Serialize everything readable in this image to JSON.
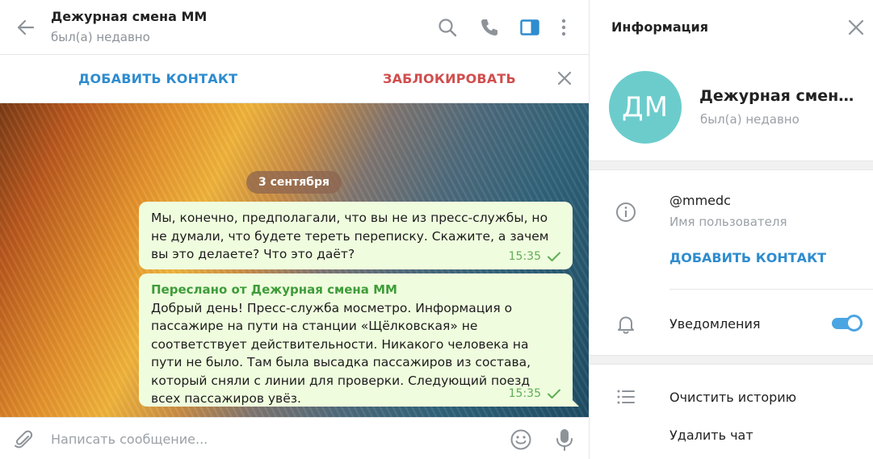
{
  "chat": {
    "title": "Дежурная смена ММ",
    "status": "был(а) недавно",
    "icons": [
      "back-arrow-icon",
      "search-icon",
      "phone-icon",
      "sidebar-toggle-icon",
      "more-vertical-icon"
    ],
    "accent_color": "#2e8ccf"
  },
  "action_bar": {
    "add_contact": "ДОБАВИТЬ КОНТАКТ",
    "block": "ЗАБЛОКИРОВАТЬ",
    "block_color": "#d14e4e"
  },
  "messages": {
    "date": "3 сентября",
    "items": [
      {
        "text": "Мы, конечно, предполагали, что вы не из пресс-службы, но не думали, что будете тереть переписку. Скажите, а зачем вы это делаете? Что это даёт?",
        "time": "15:35"
      },
      {
        "forwarded_from": "Переслано от Дежурная смена ММ",
        "text": "Добрый день! Пресс-служба мосметро. Информация о пассажире на пути на станции «Щёлковская» не соответствует действительности. Никакого человека на пути не было. Там была высадка пассажиров из состава, который сняли с линии для проверки. Следующий поезд всех пассажиров увёз.",
        "time": "15:35"
      }
    ],
    "bubble_color": "#effdde"
  },
  "composer": {
    "placeholder": "Написать сообщение...",
    "value": ""
  },
  "info_panel": {
    "title": "Информация",
    "avatar_initials": "ДМ",
    "avatar_color": "#6ccccc",
    "name": "Дежурная смена ММ",
    "status": "был(а) недавно",
    "username": "@mmedc",
    "username_label": "Имя пользователя",
    "add_contact": "ДОБАВИТЬ КОНТАКТ",
    "notifications_label": "Уведомления",
    "notifications_on": true,
    "clear_history": "Очистить историю",
    "delete_chat": "Удалить чат"
  }
}
